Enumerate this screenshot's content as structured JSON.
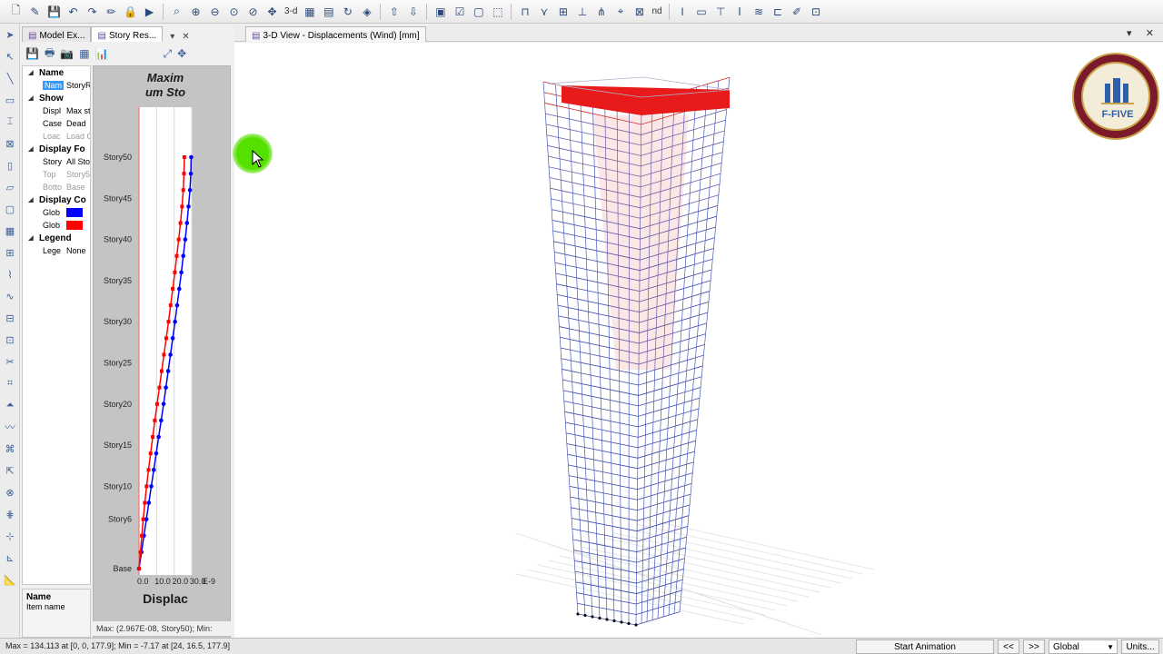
{
  "toolbar": {
    "icons": [
      "new-file",
      "open",
      "save",
      "undo",
      "redo",
      "pencil",
      "lock",
      "play",
      "zoom-window",
      "zoom-in",
      "zoom-out",
      "zoom-extents",
      "zoom-previous",
      "pan",
      "3d",
      "plan",
      "elevation",
      "rotate",
      "perspective",
      "move-up",
      "move-down",
      "objects",
      "check",
      "text",
      "extrude",
      "frame",
      "brace",
      "wall",
      "column",
      "beam",
      "select",
      "deselect",
      "properties",
      "section",
      "load",
      "assign",
      "display",
      "show",
      "design"
    ],
    "view_3d_label": "3-d",
    "nd_label": "nd"
  },
  "left_panel": {
    "tabs": [
      {
        "label": "Model Ex...",
        "active": false
      },
      {
        "label": "Story Res...",
        "active": true
      }
    ],
    "dropdown_icon": "▾",
    "close_icon": "✕"
  },
  "properties": {
    "sections": [
      {
        "header": "Name",
        "rows": [
          {
            "key": "Nam",
            "value": "StoryR",
            "selected": true
          }
        ]
      },
      {
        "header": "Show",
        "rows": [
          {
            "key": "Displ",
            "value": "Max st"
          },
          {
            "key": "Case",
            "value": "Dead"
          },
          {
            "key": "Loac",
            "value": "Load C",
            "dim": true
          }
        ]
      },
      {
        "header": "Display Fo",
        "rows": [
          {
            "key": "Story",
            "value": "All Sto"
          },
          {
            "key": "Top",
            "value": "Story5",
            "dim": true
          },
          {
            "key": "Botto",
            "value": "Base",
            "dim": true
          }
        ]
      },
      {
        "header": "Display Co",
        "rows": [
          {
            "key": "Glob",
            "swatch": "#0000ff"
          },
          {
            "key": "Glob",
            "swatch": "#ff0000"
          }
        ]
      },
      {
        "header": "Legend",
        "rows": [
          {
            "key": "Lege",
            "value": "None"
          }
        ]
      }
    ]
  },
  "description": {
    "title": "Name",
    "text": "Item name"
  },
  "chart_data": {
    "type": "line",
    "title": "Maxim um Sto",
    "xlabel": "Displac",
    "x_tick_labels": [
      "0.0",
      "10.0",
      "20.0",
      "30.0"
    ],
    "x_unit_suffix": "E-9",
    "xlim": [
      0,
      30
    ],
    "y_tick_labels": [
      "Story50",
      "Story45",
      "Story40",
      "Story35",
      "Story30",
      "Story25",
      "Story20",
      "Story15",
      "Story10",
      "Story6",
      "Base"
    ],
    "y_tick_stories": [
      50,
      45,
      40,
      35,
      30,
      25,
      20,
      15,
      10,
      6,
      0
    ],
    "ylim": [
      0,
      50
    ],
    "series": [
      {
        "color": "#0000ff",
        "stories": [
          0,
          2,
          4,
          6,
          8,
          10,
          12,
          14,
          16,
          18,
          20,
          22,
          24,
          26,
          28,
          30,
          32,
          34,
          36,
          38,
          40,
          42,
          44,
          46,
          48,
          50
        ],
        "values": [
          0,
          1.4,
          2.8,
          4.2,
          5.6,
          7,
          8.4,
          9.8,
          11.2,
          12.6,
          14,
          15.3,
          16.6,
          17.9,
          19.2,
          20.5,
          21.7,
          22.9,
          24.1,
          25.2,
          26.3,
          27.3,
          28.2,
          29.0,
          29.5,
          29.7
        ]
      },
      {
        "color": "#ff0000",
        "stories": [
          0,
          2,
          4,
          6,
          8,
          10,
          12,
          14,
          16,
          18,
          20,
          22,
          24,
          26,
          28,
          30,
          32,
          34,
          36,
          38,
          40,
          42,
          44,
          46,
          48,
          50
        ],
        "values": [
          0,
          0.8,
          1.6,
          2.4,
          3.3,
          4.3,
          5.4,
          6.6,
          7.8,
          9.0,
          10.3,
          11.6,
          12.9,
          14.2,
          15.5,
          16.8,
          18.0,
          19.2,
          20.4,
          21.5,
          22.6,
          23.6,
          24.5,
          25.2,
          25.6,
          25.8
        ]
      }
    ]
  },
  "chart_status": "Max: (2.967E-08, Story50);  Min:",
  "view": {
    "tab_label": "3-D View  - Displacements (Wind)  [mm]",
    "close_icon": "✕",
    "dropdown_icon": "▾",
    "logo_text": "F-FIVE"
  },
  "statusbar": {
    "text": "Max = 134.113 at [0, 0, 177.9];  Min = -7.17 at [24, 16.5, 177.9]",
    "start_animation": "Start Animation",
    "prev": "<<",
    "next": ">>",
    "coord_system": "Global",
    "units": "Units..."
  }
}
